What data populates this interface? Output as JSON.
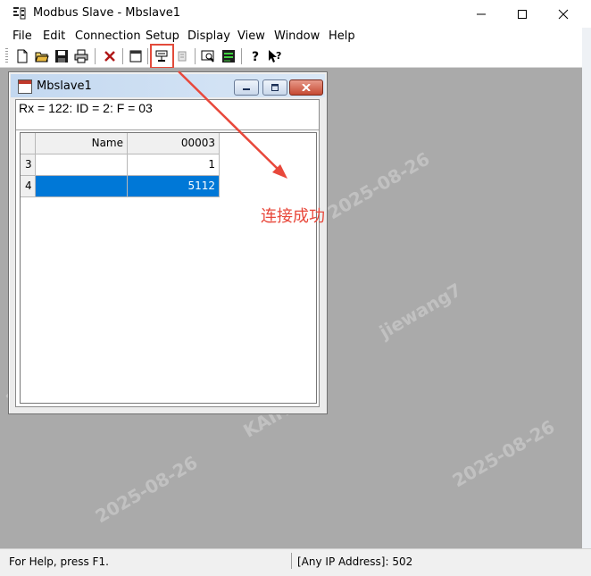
{
  "app": {
    "title": "Modbus Slave - Mbslave1",
    "menu": [
      "File",
      "Edit",
      "Connection",
      "Setup",
      "Display",
      "View",
      "Window",
      "Help"
    ]
  },
  "child": {
    "title": "Mbslave1",
    "status_line": "Rx = 122: ID = 2: F = 03",
    "grid": {
      "header_name": "Name",
      "header_col": "00003",
      "rows": [
        {
          "num": "3",
          "name": "",
          "value": "1"
        },
        {
          "num": "4",
          "name": "",
          "value": "5112",
          "selected": true
        }
      ]
    }
  },
  "annotation": {
    "text": "连接成功",
    "color": "#e8483b"
  },
  "statusbar": {
    "help": "For Help, press F1.",
    "address": "[Any IP Address]: 502"
  },
  "watermark": {
    "texts": [
      "KAIFA",
      "jiewang7",
      "2025-08-26"
    ]
  },
  "colors": {
    "selection": "#0078d7",
    "mdi_background": "#aaaaaa"
  }
}
